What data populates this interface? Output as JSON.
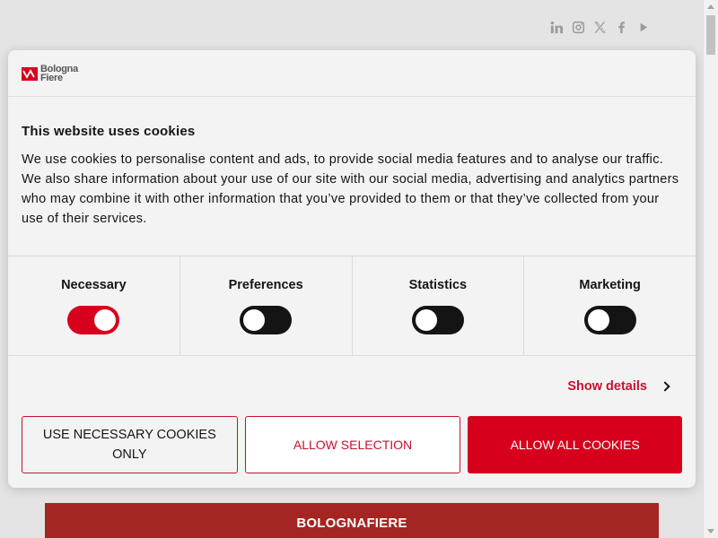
{
  "page": {
    "banner_text": "BOLOGNAFIERE",
    "social_icons": [
      "linkedin-icon",
      "instagram-icon",
      "x-icon",
      "facebook-icon",
      "youtube-icon"
    ]
  },
  "dialog": {
    "logo": {
      "line1": "Bologna",
      "line2": "Fiere"
    },
    "title": "This website uses cookies",
    "description": "We use cookies to personalise content and ads, to provide social media features and to analyse our traffic. We also share information about your use of our site with our social media, advertising and analytics partners who may combine it with other information that you’ve provided to them or that they’ve collected from your use of their services.",
    "categories": [
      {
        "label": "Necessary",
        "enabled": true
      },
      {
        "label": "Preferences",
        "enabled": false
      },
      {
        "label": "Statistics",
        "enabled": false
      },
      {
        "label": "Marketing",
        "enabled": false
      }
    ],
    "show_details": "Show details",
    "buttons": {
      "necessary": "USE NECESSARY COOKIES ONLY",
      "selection": "ALLOW SELECTION",
      "all": "ALLOW ALL COOKIES"
    }
  },
  "colors": {
    "accent": "#d6001c",
    "banner": "#a42622",
    "text": "#141414"
  }
}
